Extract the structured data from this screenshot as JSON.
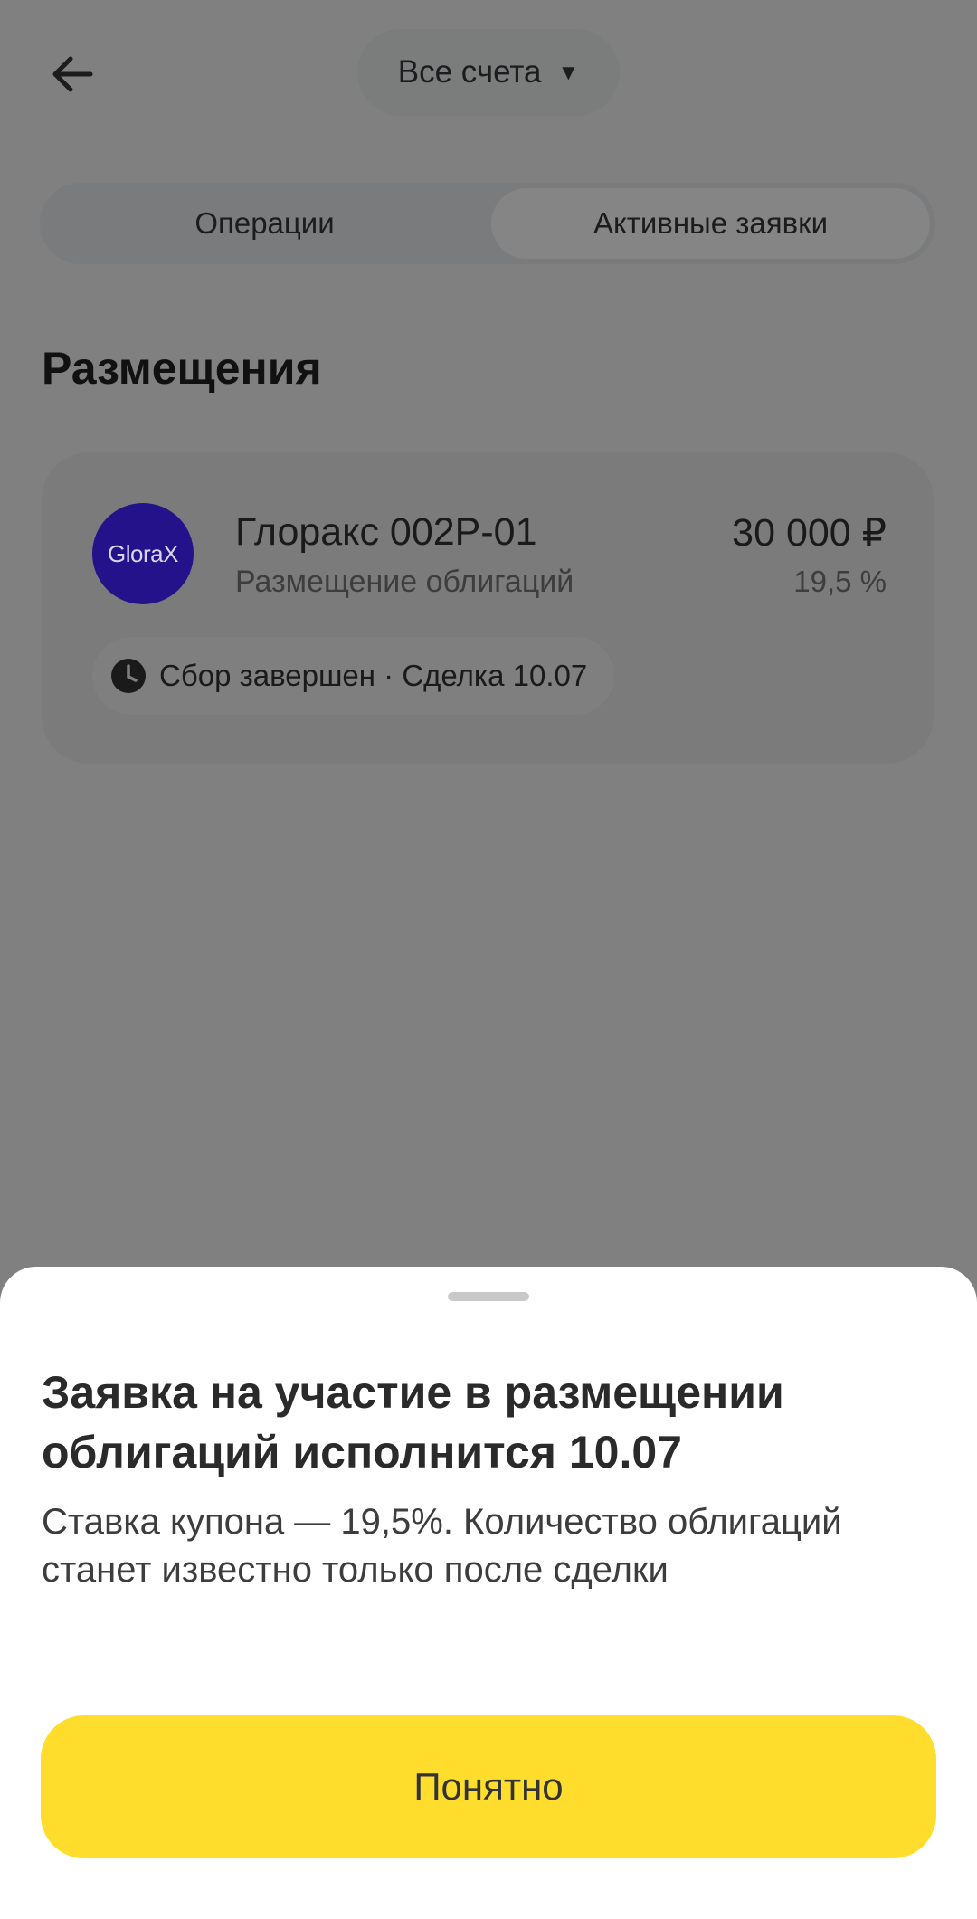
{
  "header": {
    "back_icon": "arrow-left-icon",
    "account_selector_label": "Все счета",
    "account_selector_icon": "caret-down-icon"
  },
  "tabs": [
    {
      "label": "Операции",
      "selected": false
    },
    {
      "label": "Активные заявки",
      "selected": true
    }
  ],
  "section": {
    "title": "Размещения"
  },
  "placement": {
    "logo_text": "GloraX",
    "logo_color": "#23128a",
    "name": "Глоракс 002P-01",
    "subtitle": "Размещение облигаций",
    "amount": "30 000 ₽",
    "rate": "19,5 %",
    "status_icon": "clock-icon",
    "status": "Сбор завершен · Сделка 10.07"
  },
  "sheet": {
    "title": "Заявка на участие в размещении облигаций исполнится 10.07",
    "body": "Ставка купона — 19,5%. Количество облигаций станет известно только после сделки",
    "button_label": "Понятно",
    "button_color": "#ffdd2d"
  }
}
